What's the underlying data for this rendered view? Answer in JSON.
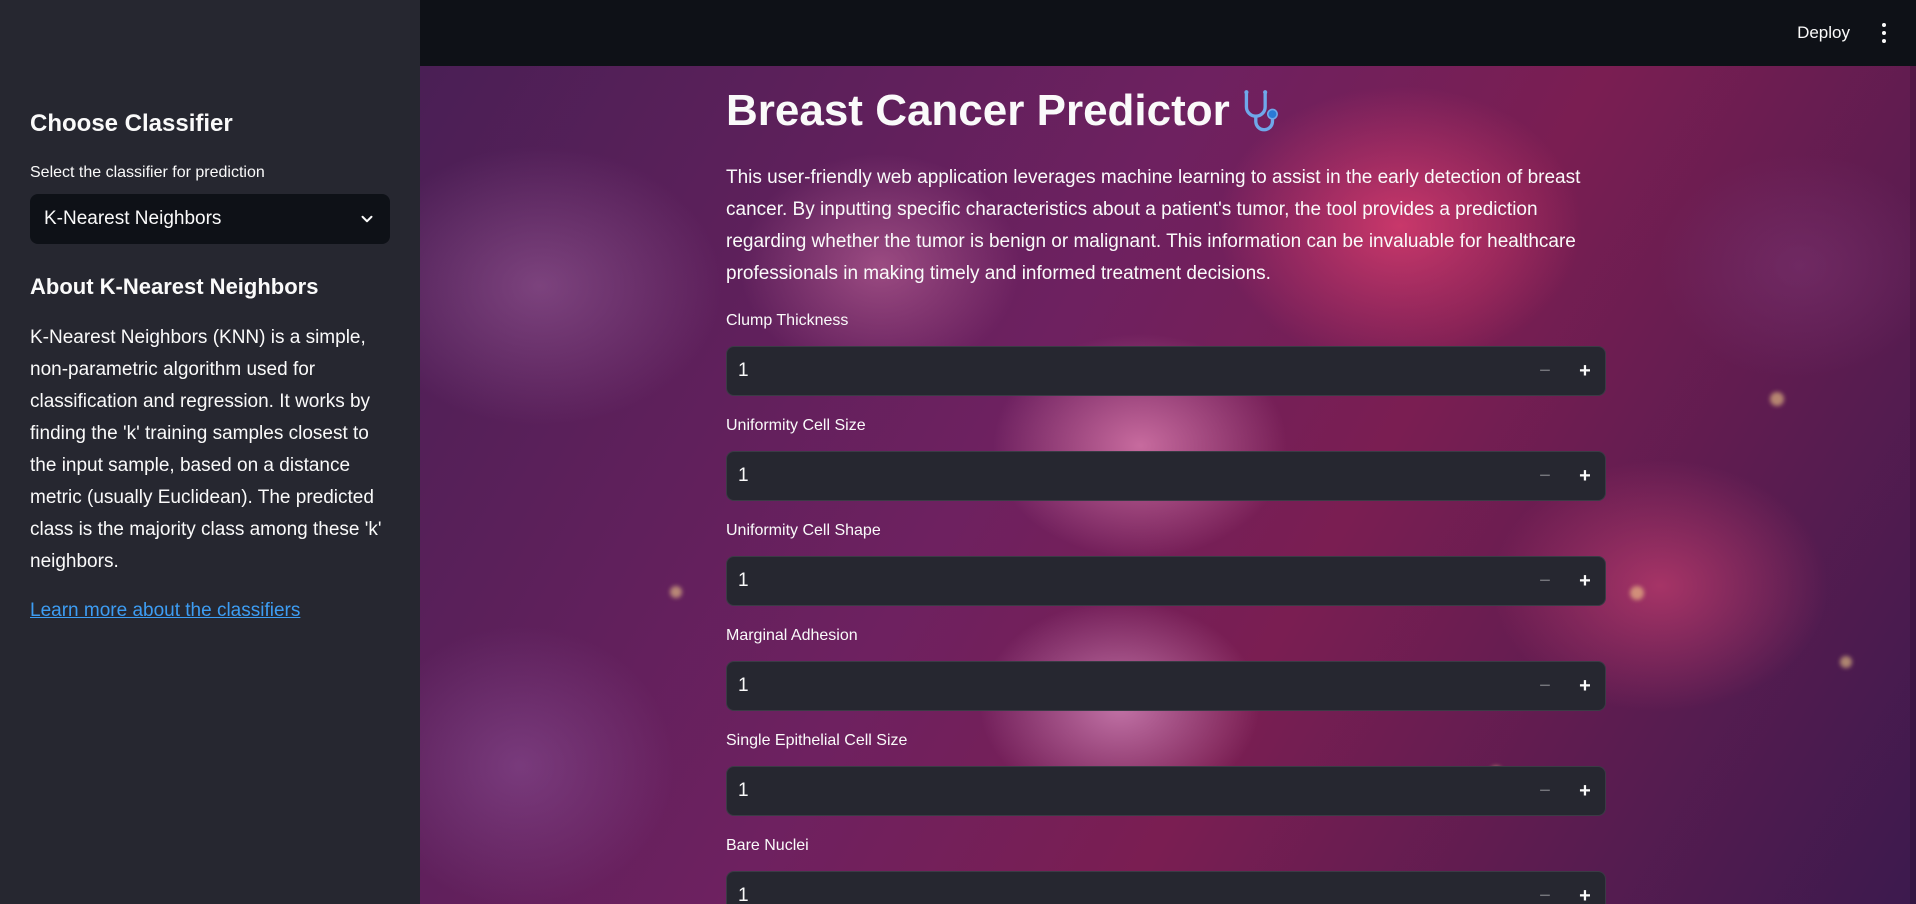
{
  "header": {
    "deploy_label": "Deploy",
    "menu_icon": "kebab-menu-icon"
  },
  "sidebar": {
    "title": "Choose Classifier",
    "select_label": "Select the classifier for prediction",
    "select_value": "K-Nearest Neighbors",
    "about_title": "About K-Nearest Neighbors",
    "about_text": "K-Nearest Neighbors (KNN) is a simple, non-parametric algorithm used for classification and regression. It works by finding the 'k' training samples closest to the input sample, based on a distance metric (usually Euclidean). The predicted class is the majority class among these 'k' neighbors.",
    "link_text": "Learn more about the classifiers"
  },
  "main": {
    "title": "Breast Cancer Predictor",
    "title_icon": "stethoscope-icon",
    "intro": "This user-friendly web application leverages machine learning to assist in the early detection of breast cancer. By inputting specific characteristics about a patient's tumor, the tool provides a prediction regarding whether the tumor is benign or malignant. This information can be invaluable for healthcare professionals in making timely and informed treatment decisions.",
    "fields": [
      {
        "label": "Clump Thickness",
        "value": "1"
      },
      {
        "label": "Uniformity Cell Size",
        "value": "1"
      },
      {
        "label": "Uniformity Cell Shape",
        "value": "1"
      },
      {
        "label": "Marginal Adhesion",
        "value": "1"
      },
      {
        "label": "Single Epithelial Cell Size",
        "value": "1"
      },
      {
        "label": "Bare Nuclei",
        "value": "1"
      }
    ],
    "minus_symbol": "−",
    "plus_symbol": "+"
  },
  "colors": {
    "accent_link": "#3d9df3",
    "sidebar_bg": "#262730",
    "header_bg": "#0e1117",
    "input_bg": "#262730"
  }
}
